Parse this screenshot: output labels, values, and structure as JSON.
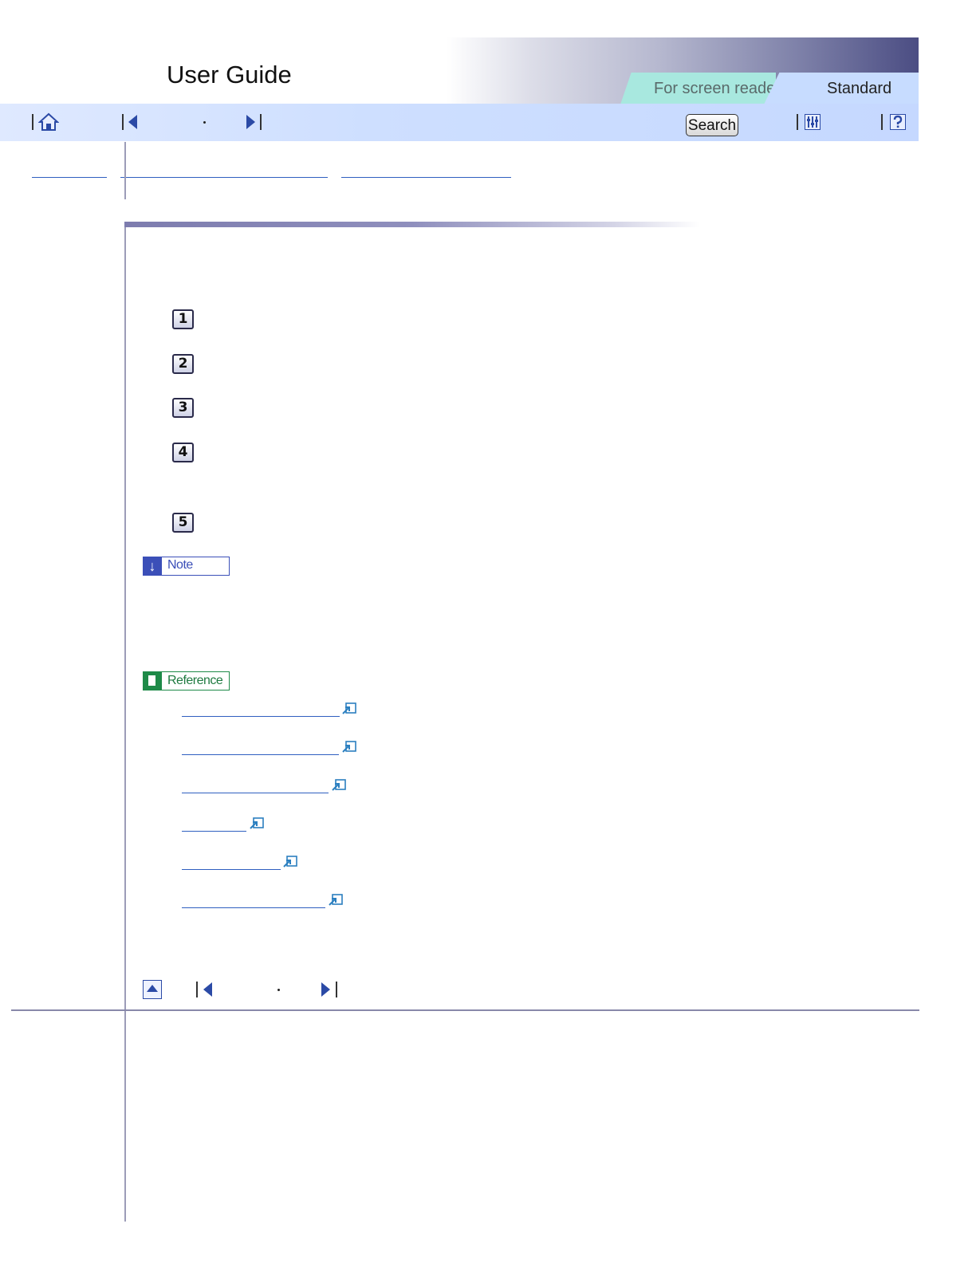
{
  "header": {
    "title": "User Guide",
    "tabs": [
      {
        "label": "For screen reader"
      },
      {
        "label": "Standard"
      }
    ]
  },
  "toolbar": {
    "search_label": "Search",
    "icons": [
      "home-icon",
      "first-page-icon",
      "next-page-icon",
      "search-button",
      "settings-icon",
      "help-icon"
    ]
  },
  "content": {
    "steps": [
      "1",
      "2",
      "3",
      "4",
      "5"
    ],
    "note_label": "Note",
    "reference_label": "Reference"
  },
  "colors": {
    "accent_blue": "#2b4aa6",
    "note_blue": "#3b4fb8",
    "reference_green": "#1e8a48",
    "tab_reader": "#a8e8df",
    "tab_standard": "#c7dcff"
  }
}
